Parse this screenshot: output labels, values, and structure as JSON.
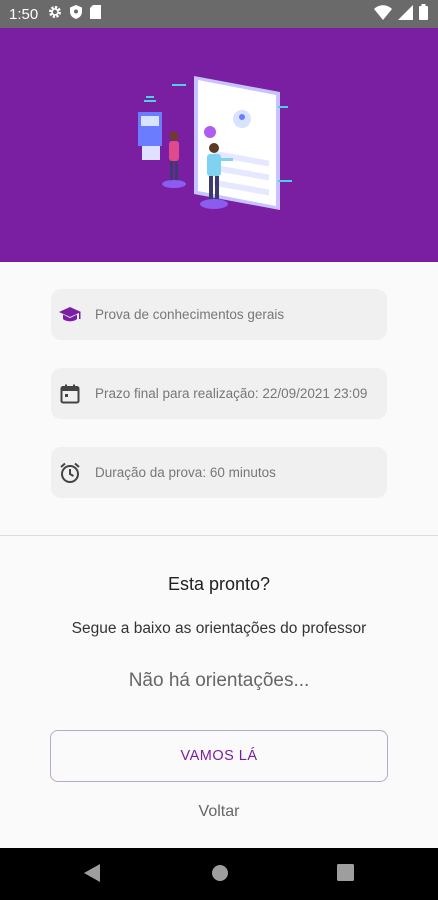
{
  "status_bar": {
    "time": "1:50",
    "left_icons": [
      "gear-icon",
      "shield-icon",
      "sd-card-icon"
    ],
    "right_icons": [
      "wifi-icon",
      "signal-icon",
      "battery-icon"
    ]
  },
  "colors": {
    "primary": "#7b1fa2",
    "status_bar": "#6a6a6a",
    "card_bg": "#f0f0f0"
  },
  "info_cards": [
    {
      "icon": "graduation-cap-icon",
      "text": "Prova de conhecimentos gerais"
    },
    {
      "icon": "calendar-icon",
      "text": "Prazo final para realização: 22/09/2021 23:09"
    },
    {
      "icon": "alarm-clock-icon",
      "text": "Duração da prova: 60 minutos"
    }
  ],
  "ready": {
    "title": "Esta pronto?",
    "subtitle": "Segue a baixo as orientações do professor",
    "orientations": "Não há orientações..."
  },
  "actions": {
    "start_label": "VAMOS LÁ",
    "back_label": "Voltar"
  },
  "nav_bar": [
    "back-icon",
    "home-icon",
    "recents-icon"
  ]
}
